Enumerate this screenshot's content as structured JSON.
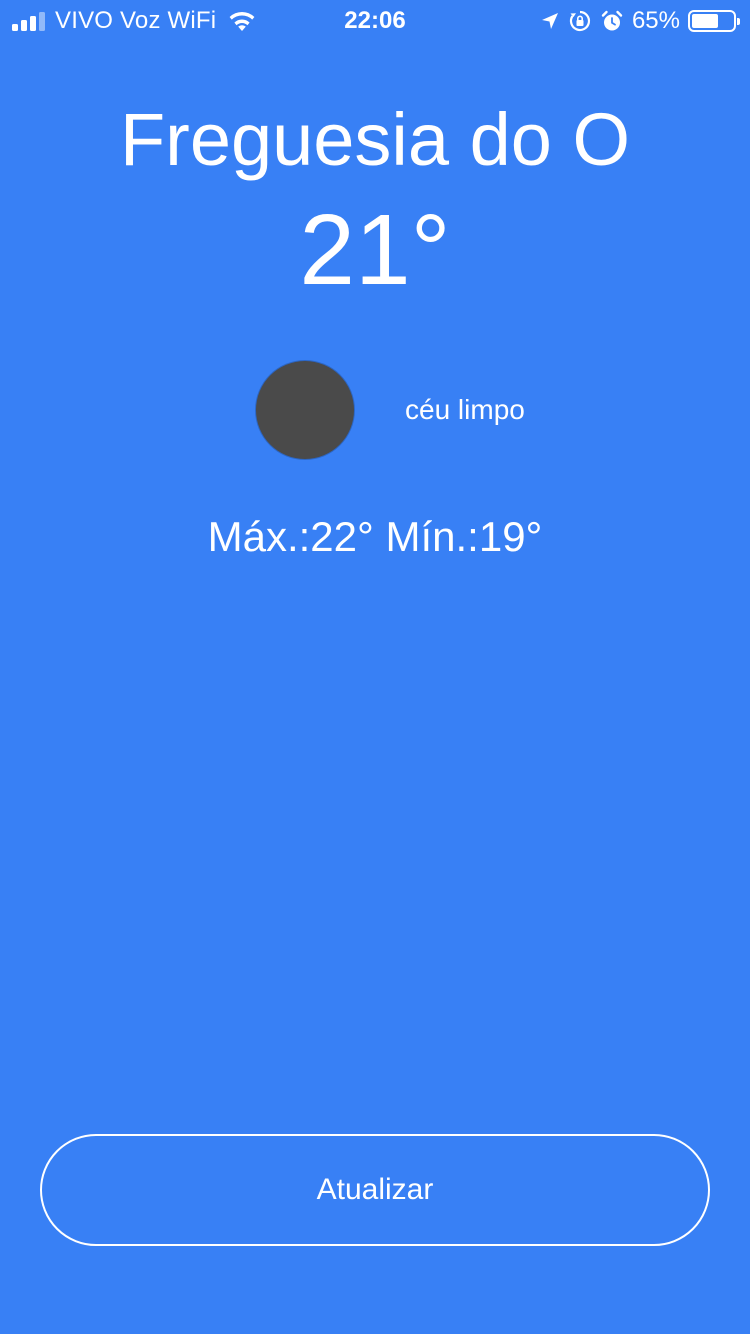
{
  "status_bar": {
    "carrier": "VIVO Voz WiFi",
    "time": "22:06",
    "battery_percent": "65%",
    "battery_level": 0.65,
    "icons": [
      "signal-icon",
      "wifi-icon",
      "location-arrow-icon",
      "orientation-lock-icon",
      "alarm-icon",
      "battery-icon"
    ]
  },
  "weather": {
    "city": "Freguesia do O",
    "temperature": "21°",
    "condition": "céu limpo",
    "min_max": "Máx.:22° Mín.:19°",
    "icon": "weather-icon"
  },
  "actions": {
    "update_label": "Atualizar"
  },
  "colors": {
    "background": "#3880F5",
    "text": "#FFFFFF",
    "icon_placeholder": "#4A4A4A"
  }
}
